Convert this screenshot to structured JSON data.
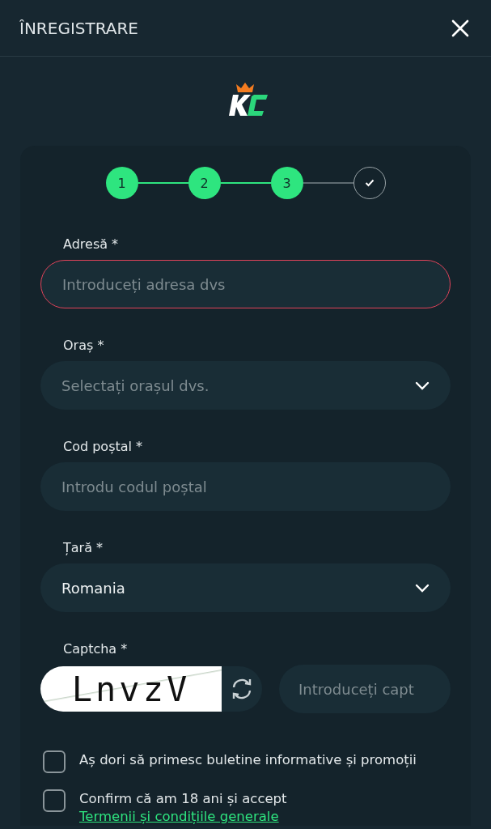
{
  "title": "ÎNREGISTRARE",
  "steps": [
    {
      "label": "1",
      "done": true
    },
    {
      "label": "2",
      "done": true
    },
    {
      "label": "3",
      "done": true
    },
    {
      "kind": "final",
      "done": false
    }
  ],
  "fields": [
    {
      "label": "Adresă *",
      "placeholder": "Introduceți adresa dvs",
      "kind": "text",
      "error": true
    },
    {
      "label": "Oraș *",
      "placeholder": "Selectați orașul dvs.",
      "kind": "select",
      "error": false
    },
    {
      "label": "Cod poștal *",
      "placeholder": "Introdu codul poștal",
      "kind": "text",
      "error": false
    },
    {
      "label": "Țară *",
      "value": "Romania",
      "kind": "select",
      "error": false
    }
  ],
  "captcha": {
    "label": "Captcha *",
    "code": "LnvzV",
    "placeholder": "Introduceți capt"
  },
  "checkboxes": [
    {
      "text": "Aș dori să primesc buletine informative și promoții",
      "checked": false
    },
    {
      "text": "Confirm că am 18 ani și accept",
      "link": "Termenii și condițiile generale",
      "checked": false
    }
  ]
}
